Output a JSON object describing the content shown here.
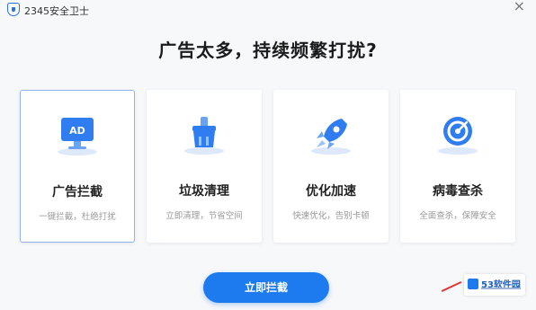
{
  "window": {
    "title": "2345安全卫士",
    "close": "×"
  },
  "headline": "广告太多，持续频繁打扰?",
  "cards": [
    {
      "icon": "ad-monitor-icon",
      "label": "广告拦截",
      "desc": "一键拦截，杜绝打扰",
      "selected": true
    },
    {
      "icon": "broom-icon",
      "label": "垃圾清理",
      "desc": "立即清理，节省空间"
    },
    {
      "icon": "rocket-icon",
      "label": "优化加速",
      "desc": "快速优化，告别卡顿"
    },
    {
      "icon": "target-icon",
      "label": "病毒查杀",
      "desc": "全面查杀，保障安全"
    }
  ],
  "icon_text": {
    "ad": "AD"
  },
  "primary_button": "立即拦截",
  "watermark": {
    "text": "53软件园"
  },
  "colors": {
    "accent": "#1e7bef",
    "icon_light": "#cfe0fb",
    "icon_dark": "#2f7df0"
  }
}
